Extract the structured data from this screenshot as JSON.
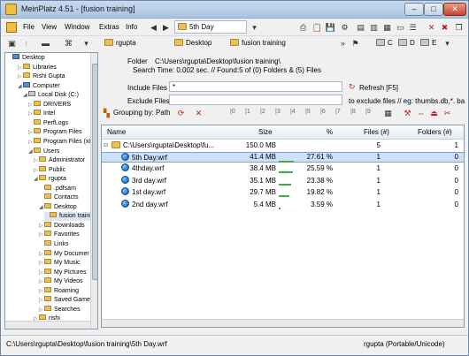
{
  "window": {
    "title": "MeinPlatz 4.51 - [fusion training]"
  },
  "menu": {
    "items": [
      "File",
      "View",
      "Window",
      "Extras",
      "Info"
    ],
    "day_combo": "5th Day"
  },
  "toolbar": {
    "user_folder": "rgupta",
    "desktop_folder": "Desktop",
    "current_folder": "fusion training",
    "drives": [
      "C",
      "D",
      "E"
    ]
  },
  "tree": {
    "items": [
      {
        "label": "Desktop",
        "icon": "desktop-icon"
      },
      {
        "label": "Libraries",
        "icon": "folder-icon"
      },
      {
        "label": "Rishi  Gupta",
        "icon": "folder-icon"
      },
      {
        "label": "Computer",
        "icon": "computer-icon"
      },
      {
        "label": "Local Disk (C:)",
        "icon": "drive-icon"
      },
      {
        "label": "DRIVERS",
        "icon": "folder-icon"
      },
      {
        "label": "Intel",
        "icon": "folder-icon"
      },
      {
        "label": "PerfLogs",
        "icon": "folder-icon"
      },
      {
        "label": "Program Files",
        "icon": "folder-icon"
      },
      {
        "label": "Program Files (x8",
        "icon": "folder-icon"
      },
      {
        "label": "Users",
        "icon": "folder-icon"
      },
      {
        "label": "Administrator",
        "icon": "folder-icon"
      },
      {
        "label": "Public",
        "icon": "folder-icon"
      },
      {
        "label": "rgupta",
        "icon": "folder-icon"
      },
      {
        "label": ".pdfsam",
        "icon": "folder-icon"
      },
      {
        "label": "Contacts",
        "icon": "folder-icon"
      },
      {
        "label": "Desktop",
        "icon": "folder-icon"
      },
      {
        "label": "fusion trainin",
        "icon": "folder-icon"
      },
      {
        "label": "Downloads",
        "icon": "folder-icon"
      },
      {
        "label": "Favorites",
        "icon": "folder-icon"
      },
      {
        "label": "Links",
        "icon": "folder-icon"
      },
      {
        "label": "My Documer",
        "icon": "folder-icon"
      },
      {
        "label": "My Music",
        "icon": "folder-icon"
      },
      {
        "label": "My Pictures",
        "icon": "folder-icon"
      },
      {
        "label": "My Videos",
        "icon": "folder-icon"
      },
      {
        "label": "Roaming",
        "icon": "folder-icon"
      },
      {
        "label": "Saved Game",
        "icon": "folder-icon"
      },
      {
        "label": "Searches",
        "icon": "folder-icon"
      },
      {
        "label": "rishi",
        "icon": "folder-icon"
      }
    ]
  },
  "panel": {
    "folder_label": "Folder",
    "folder_path": "C:\\Users\\rgupta\\Desktop\\fusion training\\",
    "search_info": "Search Time: 0.002 sec. //  Found:5 of (0) Folders & (5) Files",
    "include_label": "Include Files",
    "include_value": "*",
    "exclude_label": "Exclude Files",
    "exclude_hint": "to exclude files // eg: thumbs.db,*. ba",
    "refresh_label": "Refresh [F5]",
    "grouping_label": "Grouping by: Path"
  },
  "list": {
    "columns": [
      "Name",
      "Size",
      "%",
      "Files (#)",
      "Folders (#)"
    ],
    "group": {
      "name": "C:\\Users\\rgupta\\Desktop\\fu...",
      "size": "150.0 MB",
      "files": "5",
      "folders": "1"
    },
    "rows": [
      {
        "name": "5th Day.wrf",
        "size": "41.4 MB",
        "pct": "27.61 %",
        "pct_value": 27.61,
        "files": "1",
        "folders": "0"
      },
      {
        "name": "4thday.wrf",
        "size": "38.4 MB",
        "pct": "25.59 %",
        "pct_value": 25.59,
        "files": "1",
        "folders": "0"
      },
      {
        "name": "3rd day.wrf",
        "size": "35.1 MB",
        "pct": "23.38 %",
        "pct_value": 23.38,
        "files": "1",
        "folders": "0"
      },
      {
        "name": "1st day.wrf",
        "size": "29.7 MB",
        "pct": "19.82 %",
        "pct_value": 19.82,
        "files": "1",
        "folders": "0"
      },
      {
        "name": "2nd day.wrf",
        "size": "5.4 MB",
        "pct": "3.59 %",
        "pct_value": 3.59,
        "files": "1",
        "folders": "0"
      }
    ]
  },
  "status": {
    "path": "C:\\Users\\rgupta\\Desktop\\fusion training\\5th Day.wrf",
    "user": "rgupta (Portable/Unicode)"
  }
}
